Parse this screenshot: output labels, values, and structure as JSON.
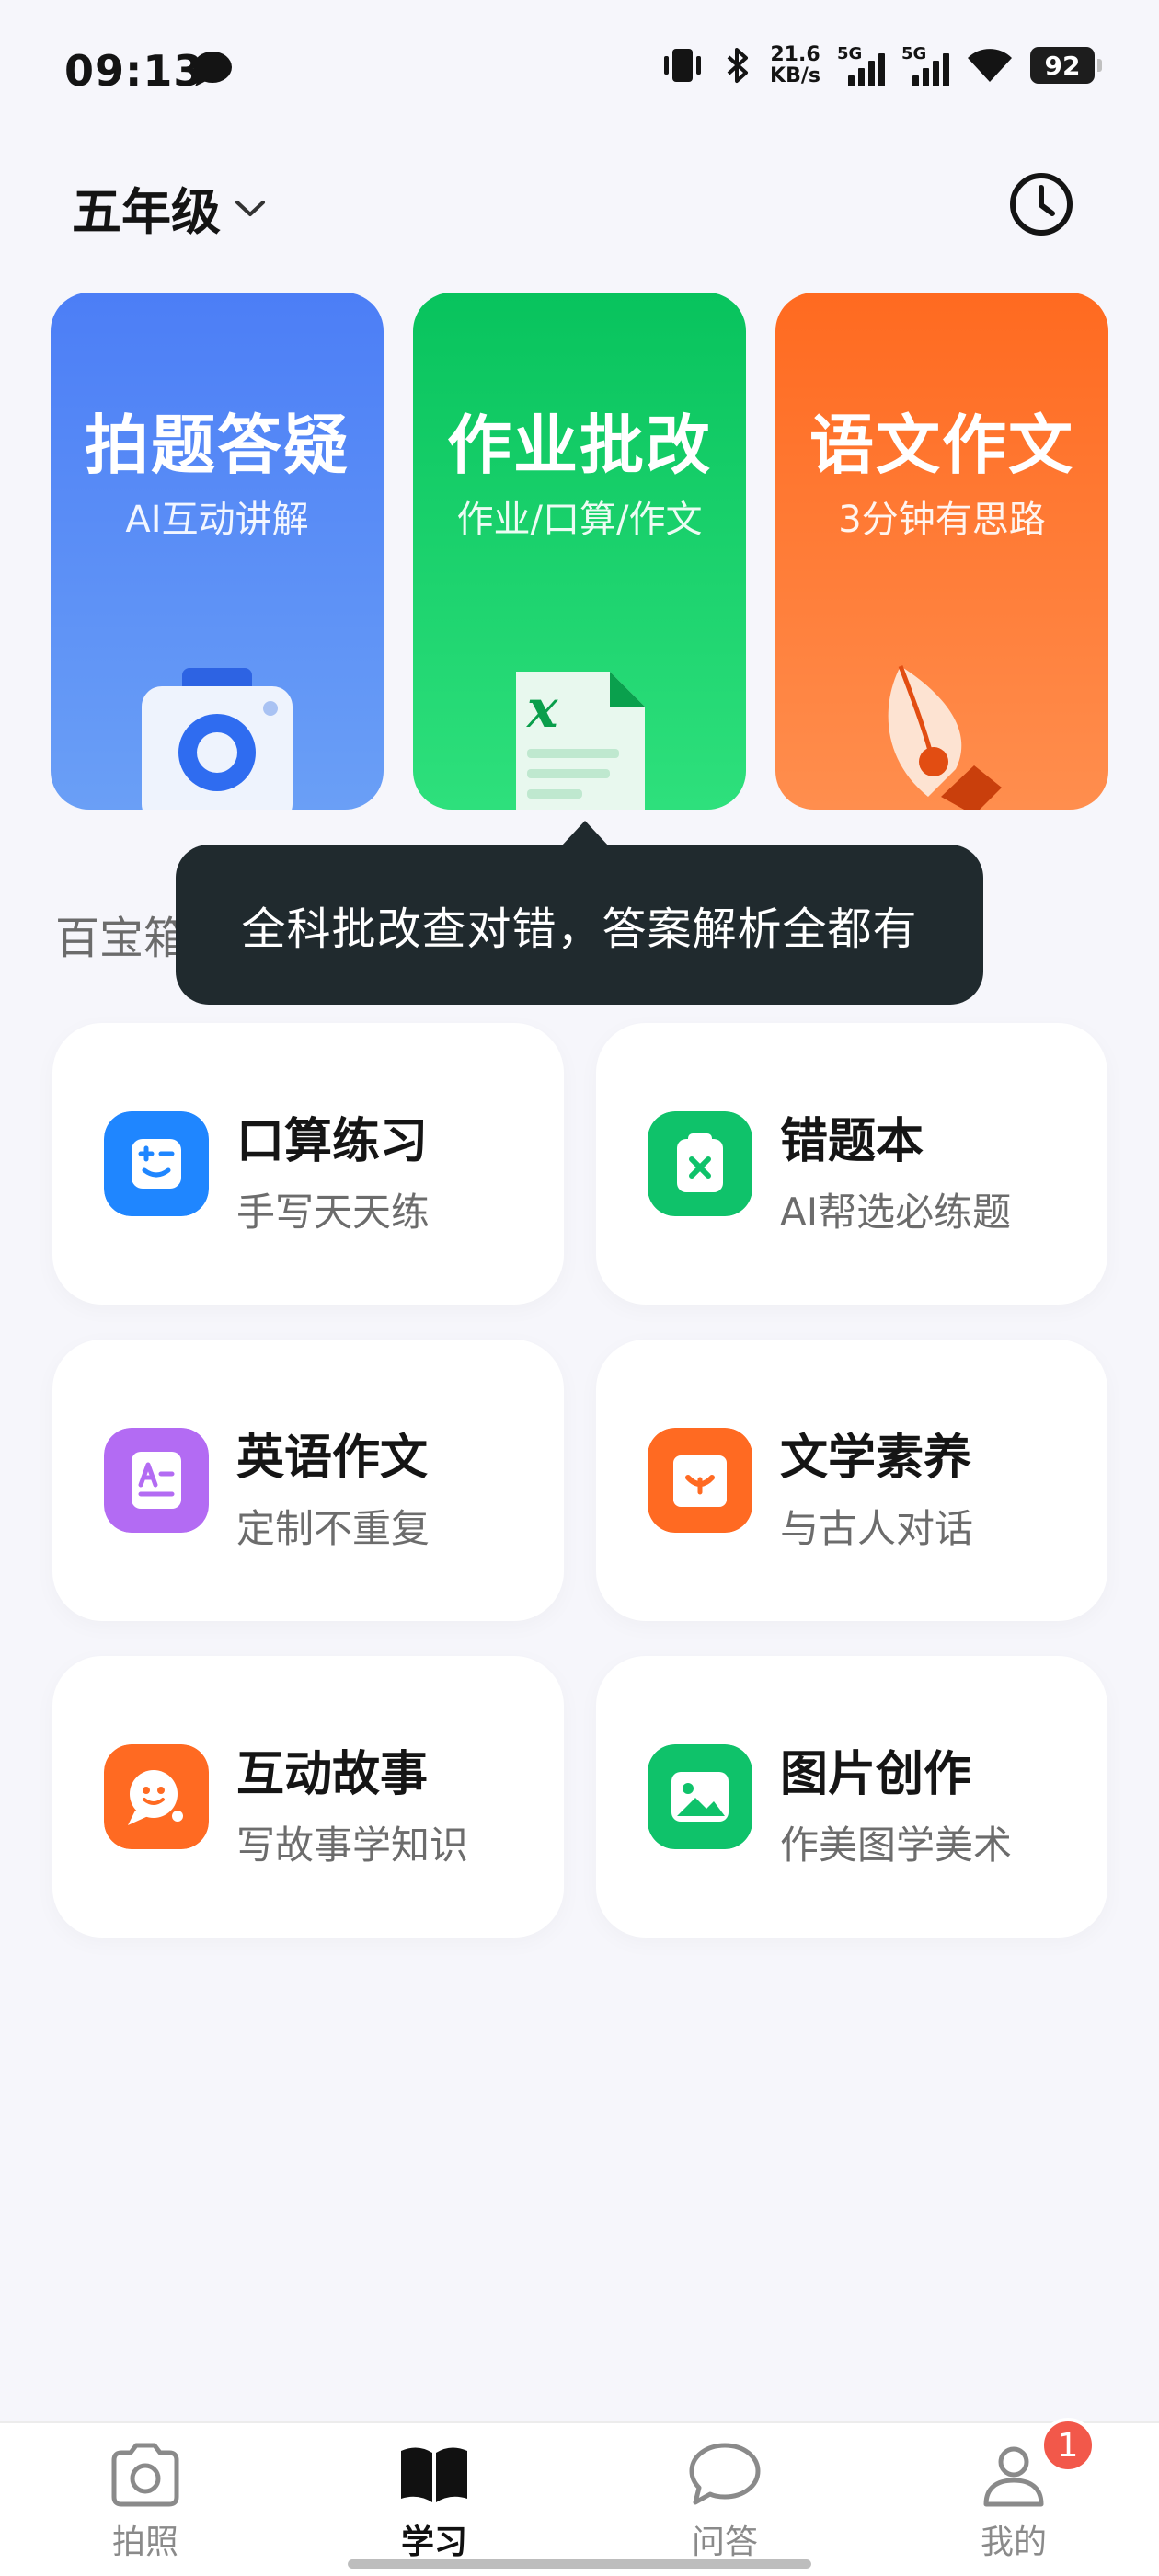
{
  "status_bar": {
    "time": "09:13",
    "net_speed_value": "21.6",
    "net_speed_unit": "KB/s",
    "sim1_label": "5G",
    "sim2_label": "5G",
    "battery": "92",
    "icons": [
      "chat-bubble-icon",
      "vibrate-icon",
      "bluetooth-icon",
      "signal-icon",
      "wifi-icon",
      "battery-icon"
    ]
  },
  "header": {
    "grade": "五年级",
    "history_icon": "clock-icon"
  },
  "hero_cards": [
    {
      "title": "拍题答疑",
      "subtitle": "AI互动讲解",
      "color": "#4c7ef6",
      "icon": "camera-icon"
    },
    {
      "title": "作业批改",
      "subtitle": "作业/口算/作文",
      "color": "#08c35d",
      "icon": "excel-document-icon"
    },
    {
      "title": "语文作文",
      "subtitle": "3分钟有思路",
      "color": "#ff6a20",
      "icon": "pen-nib-icon"
    }
  ],
  "tooltip": {
    "text": "全科批改查对错，答案解析全都有"
  },
  "section": {
    "title": "百宝箱"
  },
  "features": [
    {
      "name": "口算练习",
      "desc": "手写天天练",
      "color": "#1f86ff",
      "icon": "math-face-icon"
    },
    {
      "name": "错题本",
      "desc": "AI帮选必练题",
      "color": "#0fc26a",
      "icon": "clipboard-x-icon"
    },
    {
      "name": "英语作文",
      "desc": "定制不重复",
      "color": "#b36bf3",
      "icon": "letter-a-doc-icon"
    },
    {
      "name": "文学素养",
      "desc": "与古人对话",
      "color": "#ff6a22",
      "icon": "book-smile-icon"
    },
    {
      "name": "互动故事",
      "desc": "写故事学知识",
      "color": "#ff6a22",
      "icon": "chat-smile-icon"
    },
    {
      "name": "图片创作",
      "desc": "作美图学美术",
      "color": "#0fc26a",
      "icon": "picture-icon"
    }
  ],
  "bottom_nav": [
    {
      "label": "拍照",
      "icon": "camera-outline-icon",
      "active": false
    },
    {
      "label": "学习",
      "icon": "book-filled-icon",
      "active": true
    },
    {
      "label": "问答",
      "icon": "chat-outline-icon",
      "active": false
    },
    {
      "label": "我的",
      "icon": "person-outline-icon",
      "active": false
    }
  ],
  "profile_badge": "1"
}
